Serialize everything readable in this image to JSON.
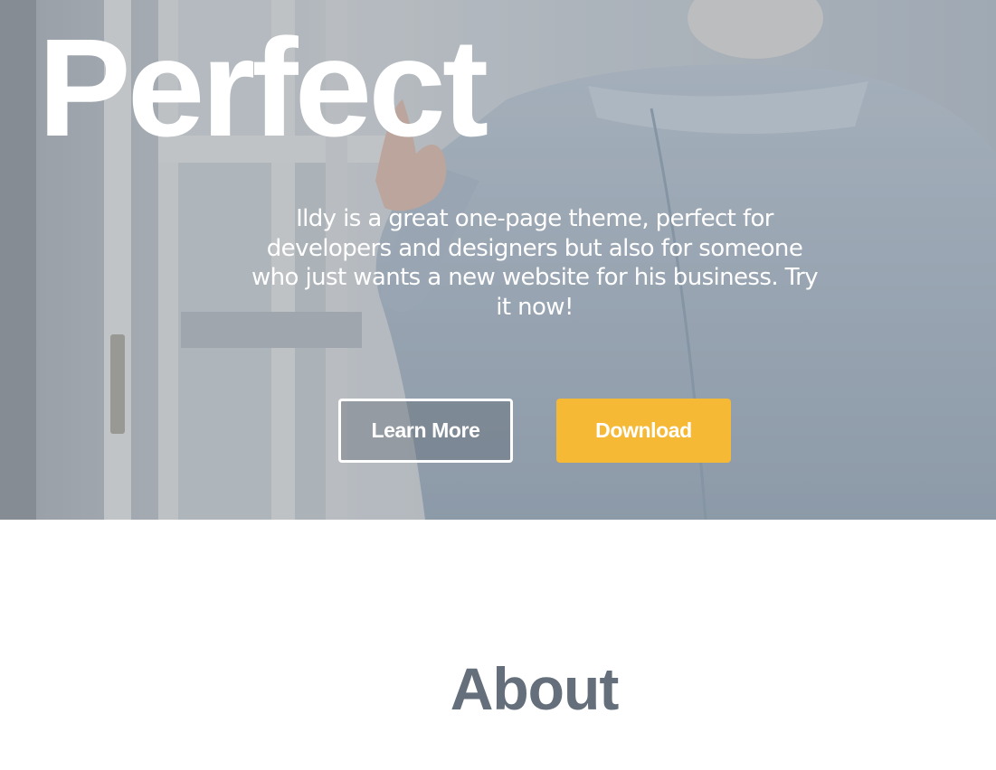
{
  "hero": {
    "title": "Perfect",
    "description": "Ildy is a great one-page theme, perfect for developers and designers but also for someone who just wants a new website for his business. Try it now!",
    "buttons": {
      "learn_more": "Learn More",
      "download": "Download"
    }
  },
  "about": {
    "title": "About"
  },
  "colors": {
    "accent": "#f5b935",
    "heading": "#646f7b",
    "hero_text": "#ffffff"
  }
}
